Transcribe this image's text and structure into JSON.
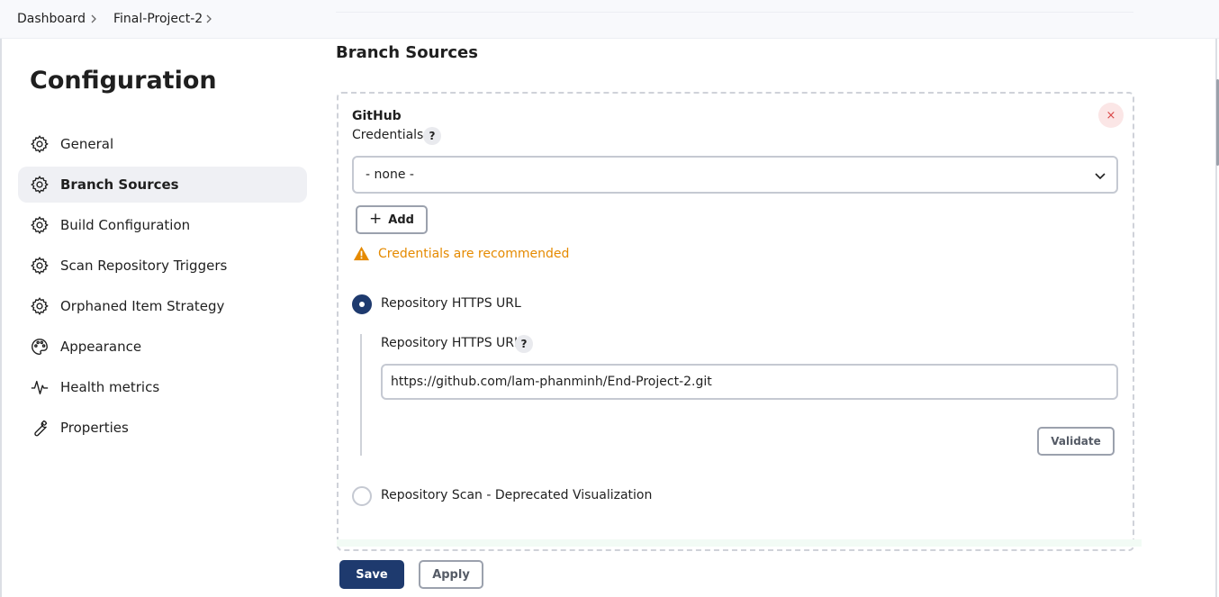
{
  "breadcrumb": [
    "Dashboard",
    "Final-Project-2"
  ],
  "sidebar": {
    "title": "Configuration",
    "items": [
      {
        "label": "General",
        "icon": "gear-icon"
      },
      {
        "label": "Branch Sources",
        "icon": "gear-icon",
        "active": true
      },
      {
        "label": "Build Configuration",
        "icon": "gear-icon"
      },
      {
        "label": "Scan Repository Triggers",
        "icon": "gear-icon"
      },
      {
        "label": "Orphaned Item Strategy",
        "icon": "gear-icon"
      },
      {
        "label": "Appearance",
        "icon": "palette-icon"
      },
      {
        "label": "Health metrics",
        "icon": "pulse-icon"
      },
      {
        "label": "Properties",
        "icon": "wrench-icon"
      }
    ]
  },
  "main": {
    "section_title": "Branch Sources",
    "source": {
      "title": "GitHub",
      "close_symbol": "×",
      "credentials_label": "Credentials",
      "help_symbol": "?",
      "credentials_value": "- none -",
      "add_label": "Add",
      "warning": "Credentials are recommended",
      "radio_https_label": "Repository HTTPS URL",
      "url_field_label": "Repository HTTPS URL",
      "url_value": "https://github.com/lam-phanminh/End-Project-2.git",
      "validate_label": "Validate",
      "radio_scan_label": "Repository Scan - Deprecated Visualization"
    }
  },
  "actions": {
    "save_label": "Save",
    "apply_label": "Apply"
  },
  "colors": {
    "primary": "#1e3a6e",
    "warning": "#e58a00",
    "danger": "#d94848"
  }
}
